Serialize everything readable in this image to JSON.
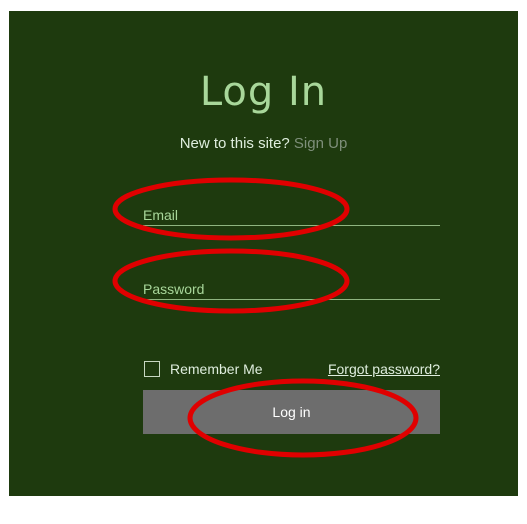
{
  "page": {
    "title": "Log In",
    "signup_prompt": "New to this site?",
    "signup_link": "Sign Up"
  },
  "form": {
    "email_placeholder": "Email",
    "password_placeholder": "Password",
    "remember_label": "Remember Me",
    "remember_checked": false,
    "forgot_label": "Forgot password?",
    "login_label": "Log in"
  },
  "colors": {
    "panel_background": "#1e3a0e",
    "title": "#a8d79a",
    "button": "#6d6d6d",
    "annotation": "#e00000"
  }
}
